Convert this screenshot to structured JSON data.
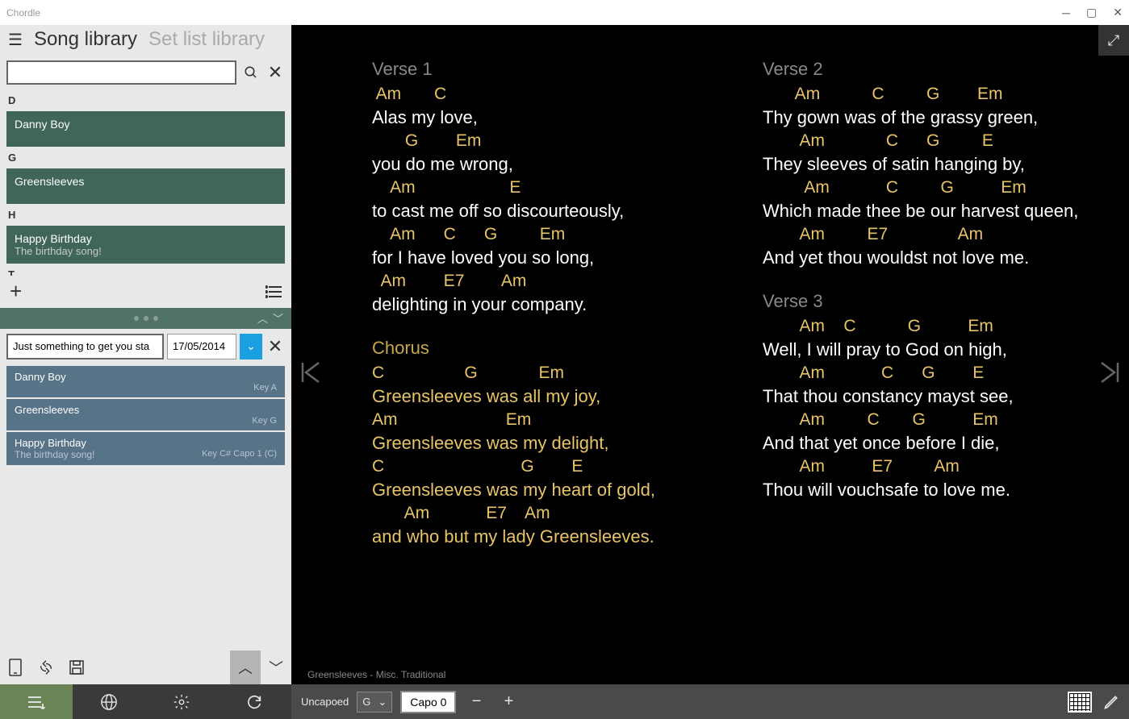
{
  "titlebar": {
    "app": "Chordle"
  },
  "header": {
    "tab1": "Song library",
    "tab2": "Set list library"
  },
  "letters": {
    "d": "D",
    "g": "G",
    "h": "H",
    "t": "T"
  },
  "songs": {
    "danny": {
      "title": "Danny Boy"
    },
    "green": {
      "title": "Greensleeves"
    },
    "happy": {
      "title": "Happy Birthday",
      "sub": "The birthday song!"
    },
    "happy2": {
      "title": "Happy Birthday",
      "sub": "The birthday song!"
    }
  },
  "setlist": {
    "name": "Just something to get you sta",
    "date": "17/05/2014",
    "items": [
      {
        "title": "Danny Boy",
        "key": "Key A"
      },
      {
        "title": "Greensleeves",
        "key": "Key G"
      },
      {
        "title": "Happy Birthday",
        "sub": "The birthday song!",
        "key": "Key C#  Capo 1 (C)"
      }
    ]
  },
  "content": {
    "v1": {
      "label": "Verse 1",
      "c1": " Am       C",
      "l1": "Alas my love,",
      "c2": "       G        Em",
      "l2": "you do me wrong,",
      "c3": "    Am                    E",
      "l3": "to cast me off so discourteously,",
      "c4": "    Am      C      G         Em",
      "l4": "for I have loved you so long,",
      "c5": "  Am        E7        Am",
      "l5": "delighting in your company."
    },
    "ch": {
      "label": "Chorus",
      "c1": "C                 G             Em",
      "l1": "Greensleeves was all my joy,",
      "c2": "Am                       Em",
      "l2": "Greensleeves was my delight,",
      "c3": "C                             G        E",
      "l3": "Greensleeves was my heart of gold,",
      "c4": "       Am            E7    Am",
      "l4": "and who but my lady Greensleeves."
    },
    "v2": {
      "label": "Verse 2",
      "c1": "       Am           C         G        Em",
      "l1": "Thy gown was of the grassy green,",
      "c2": "        Am             C      G         E",
      "l2": "They sleeves of satin hanging by,",
      "c3": "         Am            C         G          Em",
      "l3": "Which made thee be our harvest queen,",
      "c4": "        Am         E7               Am",
      "l4": "And yet thou wouldst not love me."
    },
    "v3": {
      "label": "Verse 3",
      "c1": "        Am    C           G          Em",
      "l1": "Well, I will pray to God on high,",
      "c2": "        Am            C      G        E",
      "l2": "That thou constancy mayst see,",
      "c3": "        Am         C       G          Em",
      "l3": "And that yet once before I die,",
      "c4": "        Am          E7         Am",
      "l4": "Thou will vouchsafe to love me."
    },
    "footer": "Greensleeves -  Misc. Traditional"
  },
  "bottombar": {
    "uncapoed": "Uncapoed",
    "key": "G",
    "capo": "Capo 0"
  }
}
